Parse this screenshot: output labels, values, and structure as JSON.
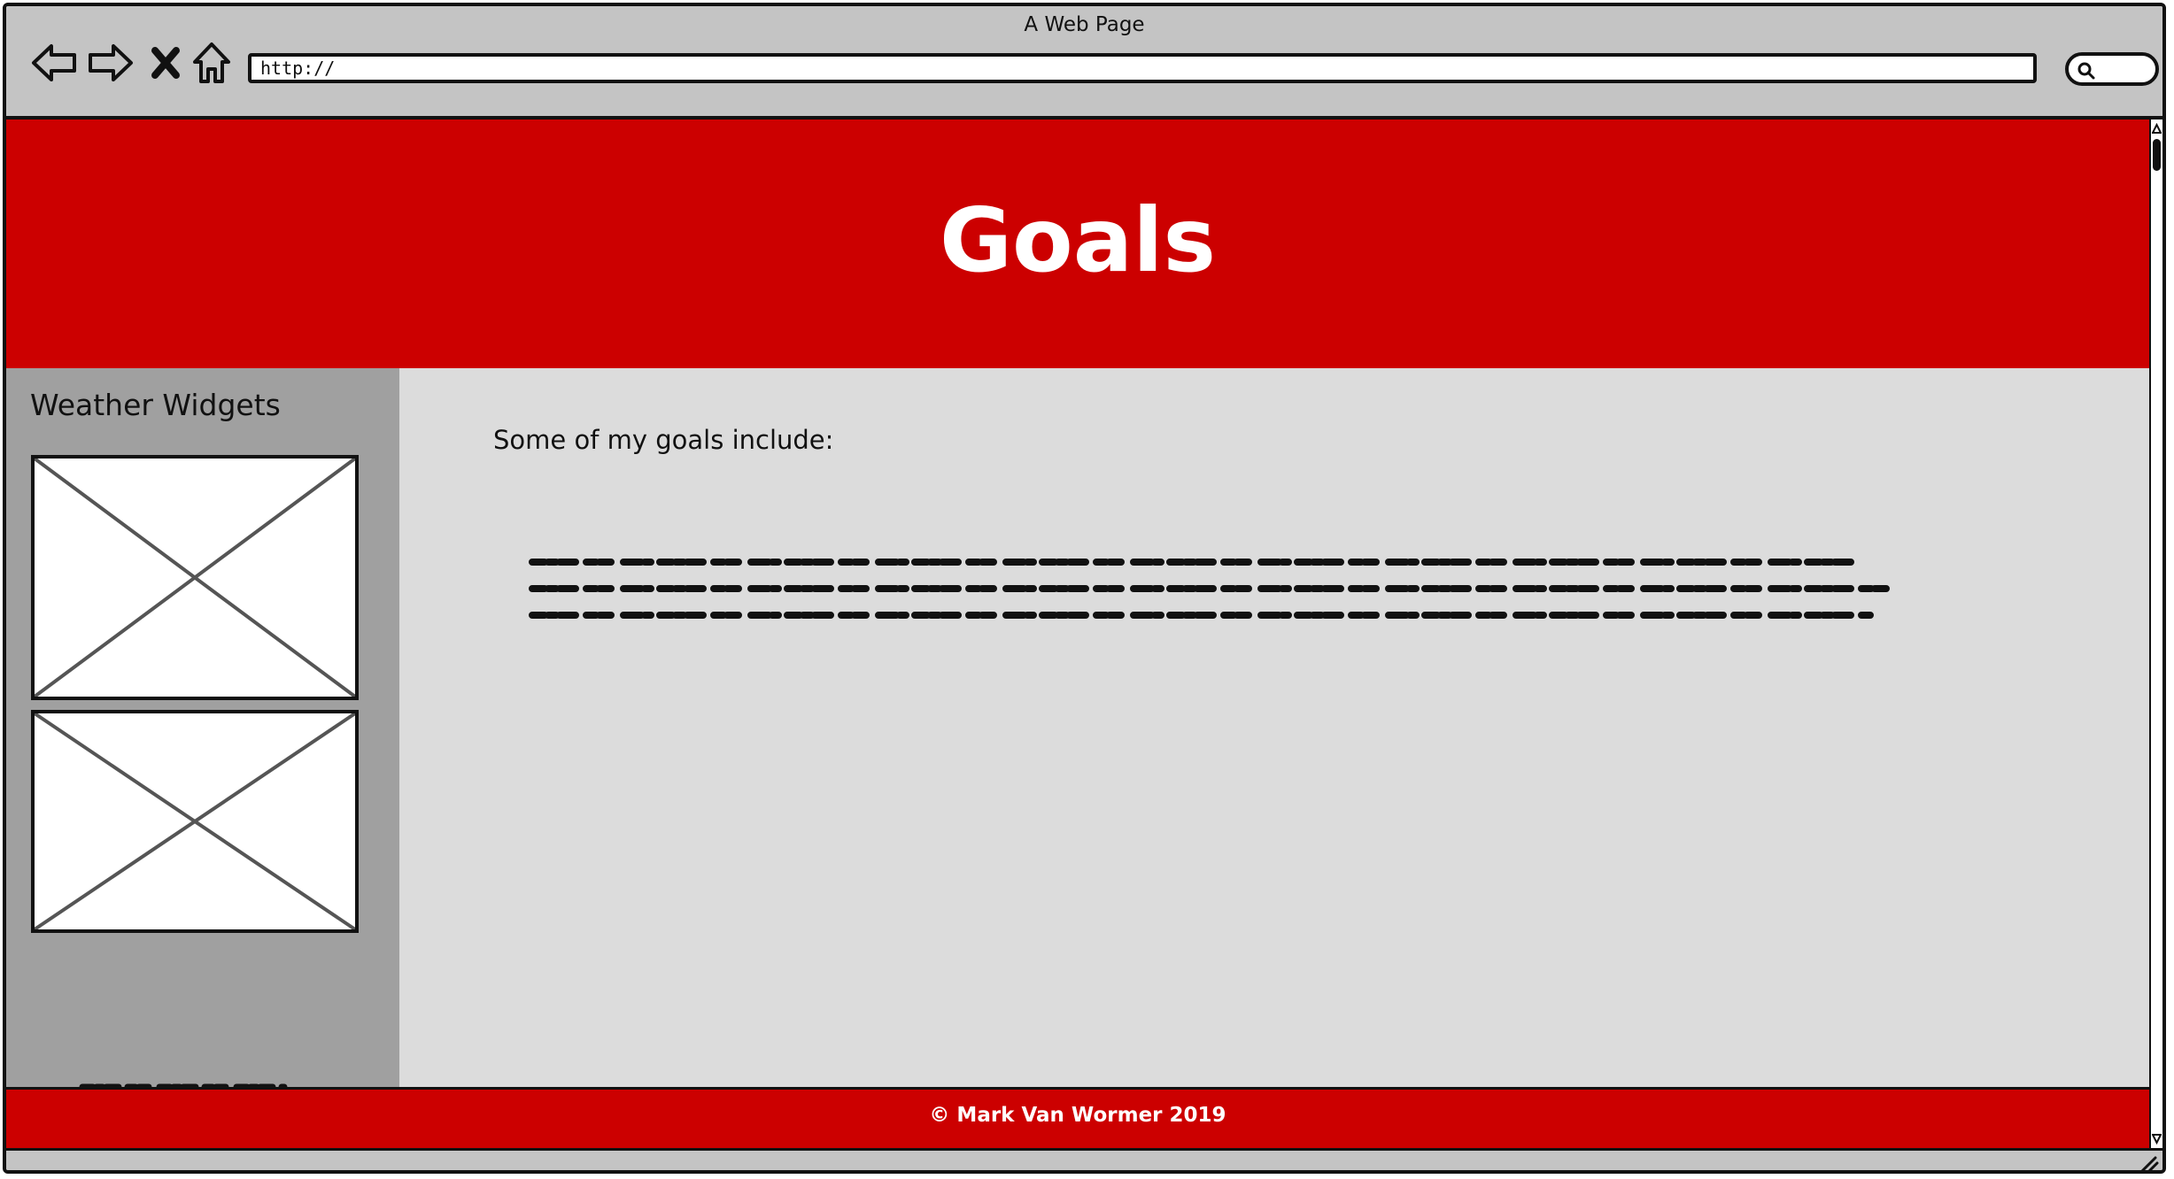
{
  "window": {
    "title": "A Web Page"
  },
  "toolbar": {
    "back_icon": "arrow-left-icon",
    "forward_icon": "arrow-right-icon",
    "stop_icon": "close-icon",
    "home_icon": "home-icon",
    "url": "http://",
    "search_icon": "search-icon"
  },
  "header": {
    "title": "Goals"
  },
  "sidebar": {
    "title": "Weather Widgets",
    "widgets": [
      "image-placeholder",
      "image-placeholder"
    ]
  },
  "main": {
    "intro": "Some of my goals include:"
  },
  "footer": {
    "text": "© Mark Van Wormer 2019"
  },
  "colors": {
    "brand_red": "#cc0000",
    "sidebar_gray": "#a0a0a0",
    "content_gray": "#dcdcdc",
    "chrome_gray": "#c4c4c4"
  }
}
